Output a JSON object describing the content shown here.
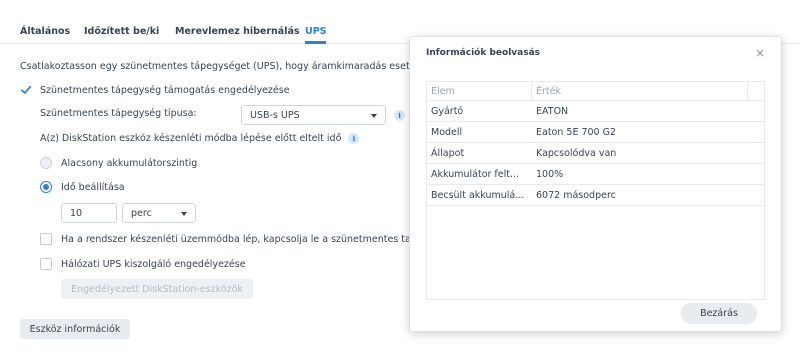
{
  "tabs": [
    {
      "label": "Általános"
    },
    {
      "label": "Időzített be/ki"
    },
    {
      "label": "Merevlemez hibernálás"
    },
    {
      "label": "UPS"
    }
  ],
  "intro_text": "Csatlakoztasson egy szünetmentes tápegységet (UPS), hogy áramkimaradás eset",
  "ups_support": {
    "label": "Szünetmentes tápegység támogatás engedélyezése",
    "checked": true
  },
  "ups_type": {
    "label": "Szünetmentes tápegység típusa:",
    "value": "USB-s UPS"
  },
  "standby_label": "A(z) DiskStation eszköz készenléti módba lépése előtt eltelt idő",
  "radio_low_battery": "Alacsony akkumulátorszintig",
  "radio_time": "Idő beállítása",
  "time_value": "10",
  "time_unit": "perc",
  "shutdown_checkbox": "Ha a rendszer készenléti üzemmódba lép, kapcsolja le a szünetmentes ta",
  "network_ups_checkbox": "Hálózati UPS kiszolgáló engedélyezése",
  "allowed_devices_button": "Engedélyezett DiskStation-eszközök",
  "device_info_button": "Eszköz információk",
  "dialog": {
    "title": "Információk beolvasás",
    "close_glyph": "×",
    "col_item": "Elem",
    "col_value": "Érték",
    "rows": [
      {
        "item": "Gyártó",
        "value": "EATON"
      },
      {
        "item": "Modell",
        "value": "Eaton 5E 700 G2"
      },
      {
        "item": "Állapot",
        "value": "Kapcsolódva van"
      },
      {
        "item": "Akkumulátor felt...",
        "value": "100%"
      },
      {
        "item": "Becsült akkumulá...",
        "value": "6072 másodperc"
      }
    ],
    "close_button": "Bezárás"
  },
  "info_glyph": "i",
  "colors": {
    "accent": "#2f80d7",
    "text": "#3a4450"
  }
}
